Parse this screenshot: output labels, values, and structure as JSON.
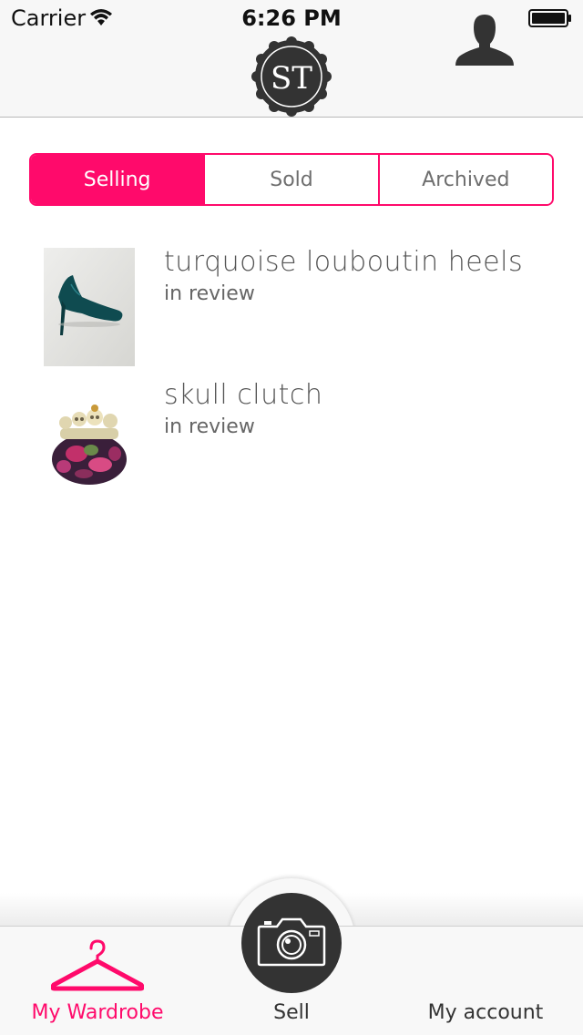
{
  "status_bar": {
    "carrier": "Carrier",
    "time": "6:26 PM"
  },
  "nav": {
    "logo_text": "ST"
  },
  "segments": [
    {
      "label": "Selling",
      "active": true
    },
    {
      "label": "Sold",
      "active": false
    },
    {
      "label": "Archived",
      "active": false
    }
  ],
  "items": [
    {
      "title": "turquoise louboutin heels",
      "status": "in review",
      "thumbnail": "teal-heel-image"
    },
    {
      "title": "skull clutch",
      "status": "in review",
      "thumbnail": "skull-clutch-image"
    }
  ],
  "tabs": {
    "wardrobe": "My Wardrobe",
    "sell": "Sell",
    "account": "My account"
  },
  "colors": {
    "accent": "#ff0a6b",
    "dark": "#333333",
    "text": "#555555"
  },
  "icons": [
    "wifi-icon",
    "battery-icon",
    "hanger-icon",
    "camera-icon",
    "person-icon"
  ]
}
